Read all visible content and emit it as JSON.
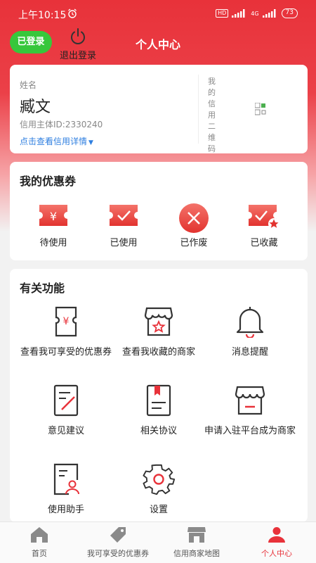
{
  "status_bar": {
    "time": "上午10:15",
    "network": "4G",
    "hd": "HD",
    "battery": "73"
  },
  "header": {
    "logged_in_label": "已登录",
    "logout_label": "退出登录",
    "title": "个人中心"
  },
  "profile": {
    "name_label": "姓名",
    "name": "臧文",
    "credit_id": "信用主体ID:2330240",
    "credit_link": "点击查看信用详情",
    "qr_label": "我的信用二维码"
  },
  "coupons": {
    "title": "我的优惠券",
    "items": [
      {
        "label": "待使用",
        "icon": "yen-ticket-icon"
      },
      {
        "label": "已使用",
        "icon": "check-ticket-icon"
      },
      {
        "label": "已作废",
        "icon": "void-circle-icon"
      },
      {
        "label": "已收藏",
        "icon": "star-ticket-icon"
      }
    ]
  },
  "functions": {
    "title": "有关功能",
    "items": [
      {
        "label": "查看我可享受的优惠券",
        "icon": "coupon-phone-icon"
      },
      {
        "label": "查看我收藏的商家",
        "icon": "store-star-icon"
      },
      {
        "label": "消息提醒",
        "icon": "bell-icon"
      },
      {
        "label": "意见建议",
        "icon": "feedback-icon"
      },
      {
        "label": "相关协议",
        "icon": "agreement-icon"
      },
      {
        "label": "申请入驻平台成为商家",
        "icon": "shop-apply-icon"
      },
      {
        "label": "使用助手",
        "icon": "assistant-icon"
      },
      {
        "label": "设置",
        "icon": "settings-gear-icon"
      }
    ]
  },
  "bottom_nav": {
    "items": [
      {
        "label": "首页",
        "icon": "home-icon"
      },
      {
        "label": "我可享受的优惠券",
        "icon": "tag-icon"
      },
      {
        "label": "信用商家地图",
        "icon": "store-map-icon"
      },
      {
        "label": "个人中心",
        "icon": "person-icon"
      }
    ],
    "active_index": 3
  },
  "colors": {
    "accent": "#e8323a",
    "logged_green": "#37c73b",
    "link_blue": "#2f7fe0"
  }
}
